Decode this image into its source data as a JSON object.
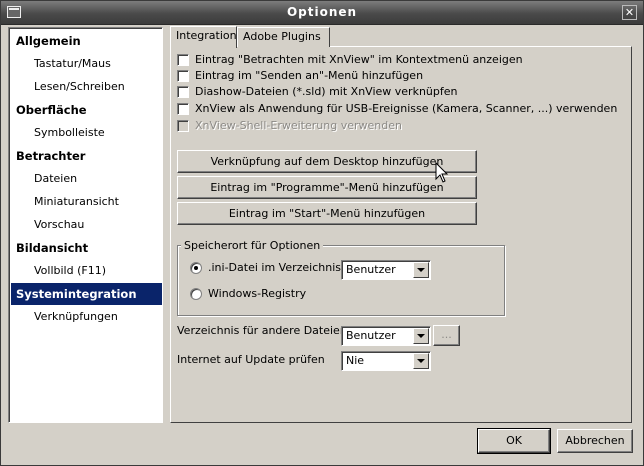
{
  "window": {
    "title": "Optionen",
    "close_glyph": "✕",
    "icon": "window-menu-icon"
  },
  "sidebar": {
    "items": [
      {
        "label": "Allgemein",
        "kind": "category"
      },
      {
        "label": "Tastatur/Maus",
        "kind": "sub"
      },
      {
        "label": "Lesen/Schreiben",
        "kind": "sub"
      },
      {
        "label": "Oberfläche",
        "kind": "category"
      },
      {
        "label": "Symbolleiste",
        "kind": "sub"
      },
      {
        "label": "Betrachter",
        "kind": "category"
      },
      {
        "label": "Dateien",
        "kind": "sub"
      },
      {
        "label": "Miniaturansicht",
        "kind": "sub"
      },
      {
        "label": "Vorschau",
        "kind": "sub"
      },
      {
        "label": "Bildansicht",
        "kind": "category"
      },
      {
        "label": "Vollbild  (F11)",
        "kind": "sub"
      },
      {
        "label": "Systemintegration",
        "kind": "category",
        "selected": true
      },
      {
        "label": "Verknüpfungen",
        "kind": "sub"
      }
    ],
    "selected_color": "#0a246a"
  },
  "tabs": [
    {
      "label": "Integration",
      "active": true
    },
    {
      "label": "Adobe Plugins",
      "active": false
    }
  ],
  "checkboxes": [
    {
      "label": "Eintrag \"Betrachten mit XnView\" im Kontextmenü anzeigen",
      "checked": false,
      "enabled": true
    },
    {
      "label": "Eintrag im \"Senden an\"-Menü hinzufügen",
      "checked": false,
      "enabled": true
    },
    {
      "label": "Diashow-Dateien (*.sld) mit XnView verknüpfen",
      "checked": false,
      "enabled": true
    },
    {
      "label": "XnView als Anwendung für USB-Ereignisse (Kamera, Scanner, ...) verwenden",
      "checked": false,
      "enabled": true
    },
    {
      "label": "XnView-Shell-Erweiterung verwenden",
      "checked": false,
      "enabled": false
    }
  ],
  "actions": {
    "desktop": "Verknüpfung auf dem Desktop hinzufügen",
    "programs": "Eintrag im \"Programme\"-Menü hinzufügen",
    "start": "Eintrag im \"Start\"-Menü hinzufügen"
  },
  "storage": {
    "legend": "Speicherort für Optionen",
    "ini_label": ".ini-Datei im Verzeichnis",
    "ini_selected": true,
    "ini_dir_value": "Benutzer",
    "registry_label": "Windows-Registry"
  },
  "other_files": {
    "label": "Verzeichnis für andere Dateien",
    "value": "Benutzer",
    "browse_label": "..."
  },
  "update_check": {
    "label": "Internet auf Update prüfen",
    "value": "Nie"
  },
  "footer": {
    "ok_label": "OK",
    "cancel_label": "Abbrechen"
  }
}
